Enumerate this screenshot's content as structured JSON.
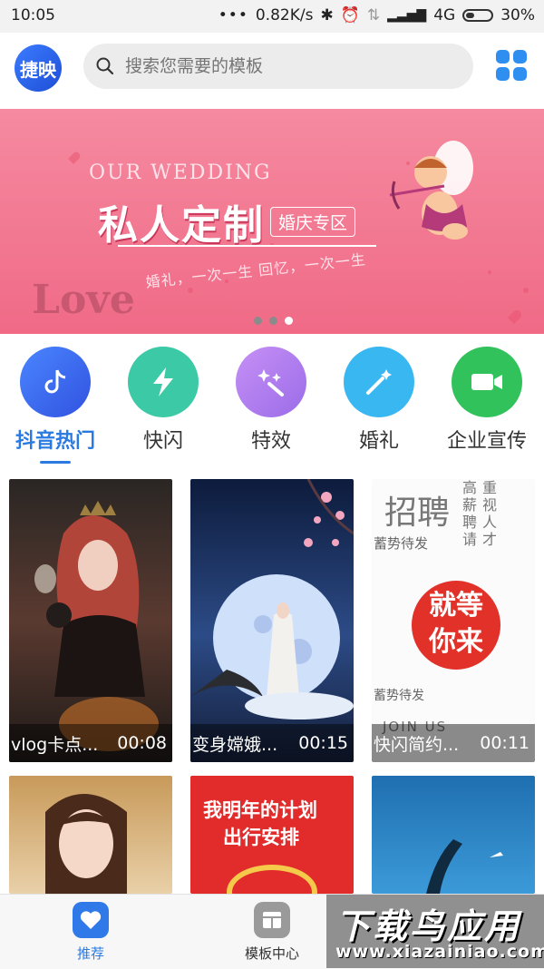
{
  "status": {
    "time": "10:05",
    "network_speed": "0.82K/s",
    "signal": "4G",
    "battery": "30%"
  },
  "header": {
    "logo_text": "捷映",
    "search_placeholder": "搜索您需要的模板"
  },
  "banner": {
    "eng_text": "OUR WEDDING",
    "title": "私人定制",
    "tag": "婚庆专区",
    "slogan": "婚礼，一次一生   回忆，一次一生",
    "love_text": "Love",
    "pages": 3,
    "active_page": 3
  },
  "categories": [
    {
      "label": "抖音热门",
      "icon": "tiktok-note-icon",
      "color": "#3b6ff0",
      "active": true
    },
    {
      "label": "快闪",
      "icon": "lightning-icon",
      "color": "#3cc9a6",
      "active": false
    },
    {
      "label": "特效",
      "icon": "magic-sparkle-icon",
      "color": "#b17df0",
      "active": false
    },
    {
      "label": "婚礼",
      "icon": "magic-wand-icon",
      "color": "#39b7f0",
      "active": false
    },
    {
      "label": "企业宣传",
      "icon": "video-camera-icon",
      "color": "#32c25c",
      "active": false
    }
  ],
  "templates": [
    {
      "title": "vlog卡点...",
      "duration": "00:08"
    },
    {
      "title": "变身嫦娥...",
      "duration": "00:15"
    },
    {
      "title": "快闪简约...",
      "duration": "00:11"
    }
  ],
  "template_texts": {
    "recruit_title": "招聘",
    "recruit_right": "高薪聘请",
    "recruit_right2": "重视人才",
    "recruit_waiting": "蓄势待发",
    "recruit_circle_line1": "就等",
    "recruit_circle_line2": "你来",
    "recruit_joinus": "JOIN US",
    "plan_line1": "我明年的计划",
    "plan_line2": "出行安排"
  },
  "bottom_nav": [
    {
      "label": "推荐",
      "icon": "heart-icon",
      "active": true
    },
    {
      "label": "模板中心",
      "icon": "template-center-icon",
      "active": false
    }
  ],
  "watermark": {
    "text": "下载鸟应用",
    "url": "www.xiazainiao.com"
  }
}
